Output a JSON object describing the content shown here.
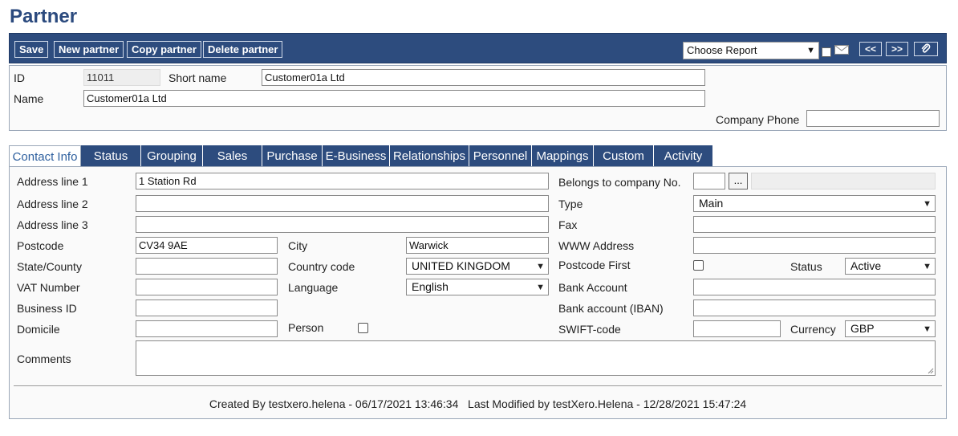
{
  "page": {
    "title": "Partner"
  },
  "toolbar": {
    "save": "Save",
    "new_partner": "New partner",
    "copy_partner": "Copy partner",
    "delete_partner": "Delete partner",
    "report_select": "Choose Report",
    "prev": "<<",
    "next": ">>"
  },
  "header": {
    "id_label": "ID",
    "id_value": "11011",
    "short_name_label": "Short name",
    "short_name_value": "Customer01a Ltd",
    "name_label": "Name",
    "name_value": "Customer01a Ltd",
    "company_phone_label": "Company Phone",
    "company_phone_value": ""
  },
  "tabs": [
    {
      "label": "Contact Info",
      "active": true
    },
    {
      "label": "Status"
    },
    {
      "label": "Grouping"
    },
    {
      "label": "Sales"
    },
    {
      "label": "Purchase"
    },
    {
      "label": "E-Business"
    },
    {
      "label": "Relationships"
    },
    {
      "label": "Personnel"
    },
    {
      "label": "Mappings"
    },
    {
      "label": "Custom"
    },
    {
      "label": "Activity"
    }
  ],
  "form": {
    "address1_label": "Address line 1",
    "address1_value": "1 Station Rd",
    "address2_label": "Address line 2",
    "address2_value": "",
    "address3_label": "Address line 3",
    "address3_value": "",
    "postcode_label": "Postcode",
    "postcode_value": "CV34 9AE",
    "city_label": "City",
    "city_value": "Warwick",
    "state_label": "State/County",
    "state_value": "",
    "country_label": "Country code",
    "country_value": "UNITED KINGDOM",
    "vat_label": "VAT Number",
    "vat_value": "",
    "language_label": "Language",
    "language_value": "English",
    "business_id_label": "Business ID",
    "business_id_value": "",
    "domicile_label": "Domicile",
    "domicile_value": "",
    "person_label": "Person",
    "comments_label": "Comments",
    "comments_value": "",
    "belongs_label": "Belongs to company No.",
    "belongs_value": "",
    "belongs_button": "...",
    "type_label": "Type",
    "type_value": "Main",
    "fax_label": "Fax",
    "fax_value": "",
    "www_label": "WWW Address",
    "www_value": "",
    "postcode_first_label": "Postcode First",
    "status_label": "Status",
    "status_value": "Active",
    "bank_account_label": "Bank Account",
    "bank_account_value": "",
    "iban_label": "Bank account (IBAN)",
    "iban_value": "",
    "swift_label": "SWIFT-code",
    "swift_value": "",
    "currency_label": "Currency",
    "currency_value": "GBP"
  },
  "footer": {
    "audit_text": "Created By testxero.helena - 06/17/2021 13:46:34   Last Modified by testXero.Helena - 12/28/2021 15:47:24"
  },
  "icons": {
    "dropdown": "chevron-down-icon",
    "mail": "mail-icon",
    "attach": "paperclip-icon"
  },
  "colors": {
    "brand": "#2d4c7e",
    "title": "#2b4a7e",
    "active_tab_text": "#2d5f9e"
  }
}
